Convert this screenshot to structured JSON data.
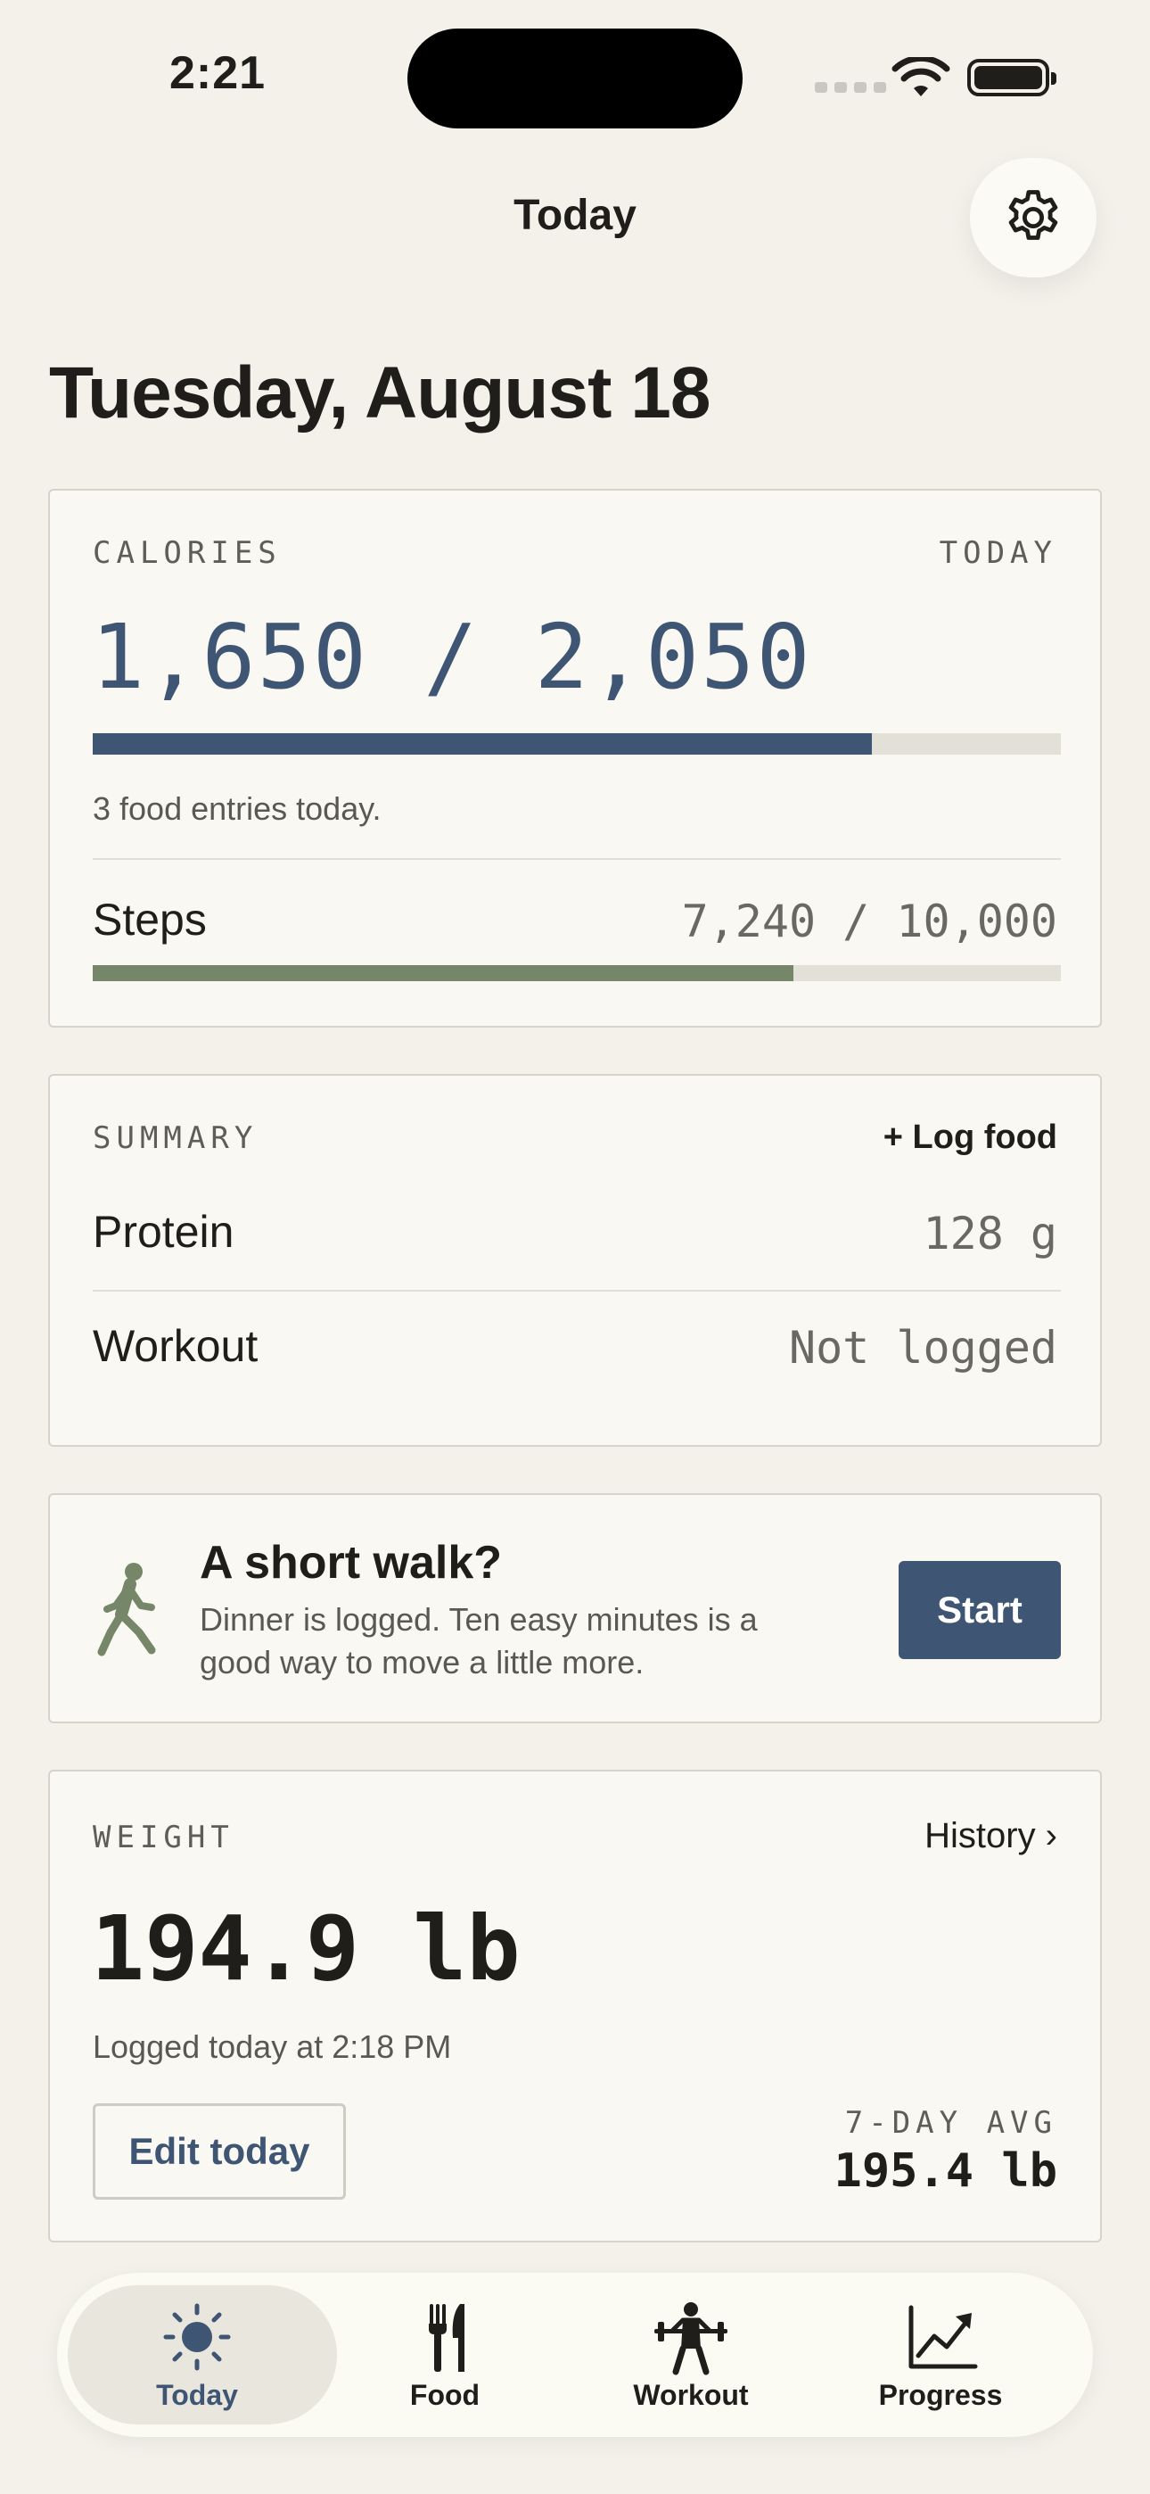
{
  "status_bar": {
    "time": "2:21"
  },
  "nav": {
    "title": "Today"
  },
  "date_heading": "Tuesday, August 18",
  "calories": {
    "eyebrow": "CALORIES",
    "period": "TODAY",
    "value_text": "1,650 / 2,050",
    "consumed": 1650,
    "goal": 2050,
    "entries_text": "3 food entries today."
  },
  "steps": {
    "label": "Steps",
    "value_text": "7,240 / 10,000",
    "count": 7240,
    "goal": 10000
  },
  "summary": {
    "eyebrow": "SUMMARY",
    "log_food_label": "+ Log food",
    "rows": [
      {
        "label": "Protein",
        "value": "128 g"
      },
      {
        "label": "Workout",
        "value": "Not logged"
      }
    ]
  },
  "walk_prompt": {
    "icon": "walking-person-icon",
    "title": "A short walk?",
    "description": "Dinner is logged. Ten easy minutes is a good way to move a little more.",
    "button_label": "Start"
  },
  "weight": {
    "eyebrow": "WEIGHT",
    "history_label": "History ›",
    "value": "194.9 lb",
    "logged_text": "Logged today at 2:18 PM",
    "edit_label": "Edit today",
    "avg_label": "7-DAY AVG",
    "avg_value": "195.4 lb"
  },
  "tabs": [
    {
      "label": "Today",
      "icon": "sun-icon",
      "active": true
    },
    {
      "label": "Food",
      "icon": "fork-knife-icon",
      "active": false
    },
    {
      "label": "Workout",
      "icon": "weightlifter-icon",
      "active": false
    },
    {
      "label": "Progress",
      "icon": "chart-trend-icon",
      "active": false
    }
  ],
  "colors": {
    "accent": "#3f5574",
    "steps": "#768769",
    "background": "#f3f1ea",
    "card": "#faf8f2"
  }
}
